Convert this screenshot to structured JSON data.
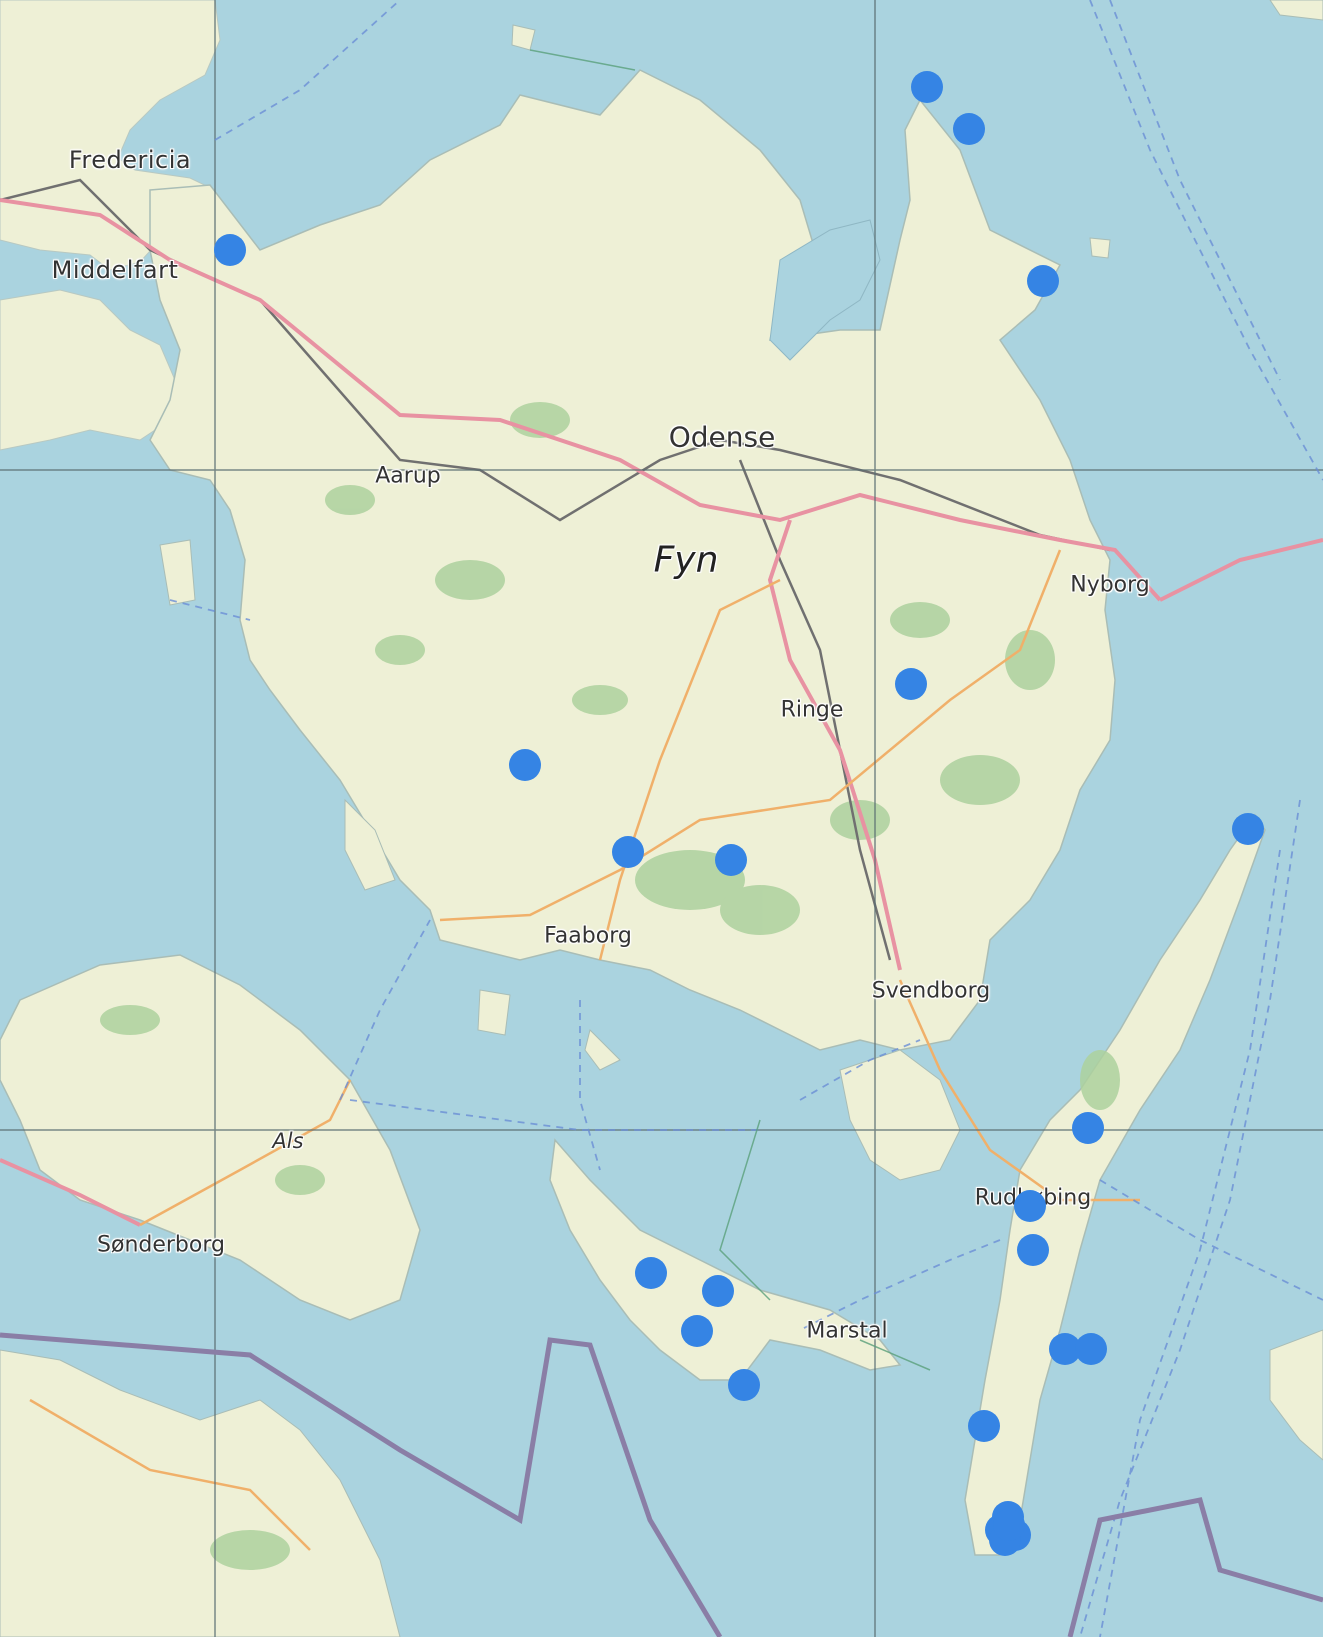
{
  "map": {
    "region": "Fyn",
    "colors": {
      "water": "#aad3df",
      "land": "#f2efe9",
      "land_tint": "#eef0d6",
      "forest": "#add19e",
      "motorway": "#e892a2",
      "primary_road": "#fcd6a4",
      "railway": "#707070",
      "border": "#8a7ea6",
      "graticule": "#5a6e72",
      "ferry": "#6b8fd6",
      "marker": "#3584e4"
    },
    "labels": {
      "fredericia": "Fredericia",
      "middelfart": "Middelfart",
      "aarup": "Aarup",
      "odense": "Odense",
      "fyn": "Fyn",
      "nyborg": "Nyborg",
      "ringe": "Ringe",
      "faaborg": "Faaborg",
      "svendborg": "Svendborg",
      "als": "Als",
      "sonderborg": "Sønderborg",
      "rudkobing": "Rudkøbing",
      "marstal": "Marstal"
    },
    "marker_count": 24
  }
}
